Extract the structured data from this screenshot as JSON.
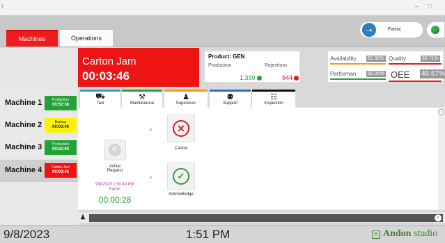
{
  "window": {
    "left_mark": "ǀ",
    "min": "–",
    "max": "□"
  },
  "header": {
    "tabs": [
      {
        "label": "Machines"
      },
      {
        "label": "Operations"
      }
    ],
    "user": {
      "name": "Famic",
      "icon": "user-login-icon"
    },
    "status_color": "#2db34a"
  },
  "alarm": {
    "title": "Carton Jam",
    "time": "00:03:46",
    "color": "#ee1414"
  },
  "product": {
    "title": "Product: GEN",
    "production_label": "Production",
    "rejections_label": "Rejections",
    "production_value": "1,399",
    "rejections_value": "944"
  },
  "kpis": {
    "availability": {
      "label": "Availability",
      "value": "61.98%",
      "color": "#f29a1a"
    },
    "quality": {
      "label": "Quality",
      "value": "59.71%",
      "color": "#e01b1b"
    },
    "performance": {
      "label": "Performan",
      "value": "95.35%",
      "color": "#2a9f3a"
    },
    "oee": {
      "label": "OEE",
      "value": "46.67%",
      "color": "#e01b1b"
    }
  },
  "machines": [
    {
      "name": "Machine 1",
      "status": "Production",
      "time": "00:52:38",
      "color": "#21a336",
      "text": "#ffffff"
    },
    {
      "name": "Machine 2",
      "status": "Backup",
      "time": "00:03:46",
      "color": "#fff200",
      "text": "#111111"
    },
    {
      "name": "Machine 3",
      "status": "Production",
      "time": "00:51:03",
      "color": "#21a336",
      "text": "#ffffff"
    },
    {
      "name": "Machine 4",
      "status": "Carton Jam",
      "time": "00:03:46",
      "color": "#ee1414",
      "text": "#ffffff"
    }
  ],
  "tabs": [
    {
      "label": "Taxi",
      "color": "#2a9fd6",
      "icon": "forklift-icon",
      "glyph": "⛟"
    },
    {
      "label": "Maintenance",
      "color": "#2a9f3a",
      "icon": "tools-icon",
      "glyph": "⚒"
    },
    {
      "label": "Supervisor",
      "color": "#f29a1a",
      "icon": "supervisor-icon",
      "glyph": "♟"
    },
    {
      "label": "Support",
      "color": "#2a6fc1",
      "icon": "support-team-icon",
      "glyph": "⚉"
    },
    {
      "label": "Inspection",
      "color": "#111111",
      "icon": "inspection-icon",
      "glyph": "☷"
    }
  ],
  "request": {
    "title_line1": "Active",
    "title_line2": "Request",
    "date": "9/8/2023 1:50:49 PM",
    "user": "Famic",
    "timer": "00:00:28",
    "icon": "phone-call-icon"
  },
  "actions": {
    "cancel": {
      "label": "Cancel",
      "icon": "cancel-x-icon",
      "glyph": "✕"
    },
    "acknowledge": {
      "label": "Acknowledge",
      "icon": "acknowledge-check-icon",
      "glyph": "✓"
    }
  },
  "footer": {
    "date": "9/8/2023",
    "time": "1:51 PM",
    "brand_a": "Andon",
    "brand_b": "studio"
  }
}
